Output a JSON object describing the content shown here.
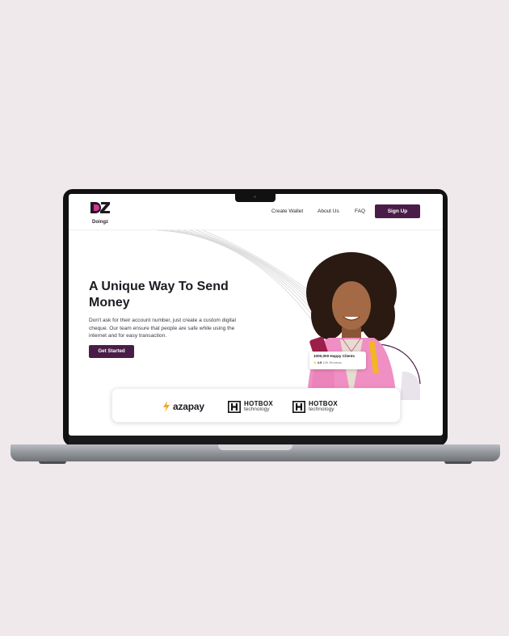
{
  "brand": {
    "name": "Doingz",
    "accent": "#4a1d48",
    "logo_accent": "#d6359a"
  },
  "nav": {
    "links": [
      {
        "label": "Create Wallet"
      },
      {
        "label": "About Us"
      },
      {
        "label": "FAQ"
      }
    ],
    "signup_label": "Sign Up"
  },
  "hero": {
    "title": "A Unique Way To Send Money",
    "description": "Don't ask for their account number, just create a custom digital cheque. Our team ensure that people are safe while using the internet and for easy transaction.",
    "cta_label": "Get Started"
  },
  "stats_card": {
    "title": "1000,000 Happy Clients",
    "rating": "4.9",
    "reviews": "10K Reviews"
  },
  "partners": [
    {
      "name": "azapay",
      "icon": "lightning-icon"
    },
    {
      "name": "HOTBOX",
      "subtitle": "technology",
      "icon": "hotbox-logo-icon"
    },
    {
      "name": "HOTBOX",
      "subtitle": "technology",
      "icon": "hotbox-logo-icon"
    }
  ]
}
